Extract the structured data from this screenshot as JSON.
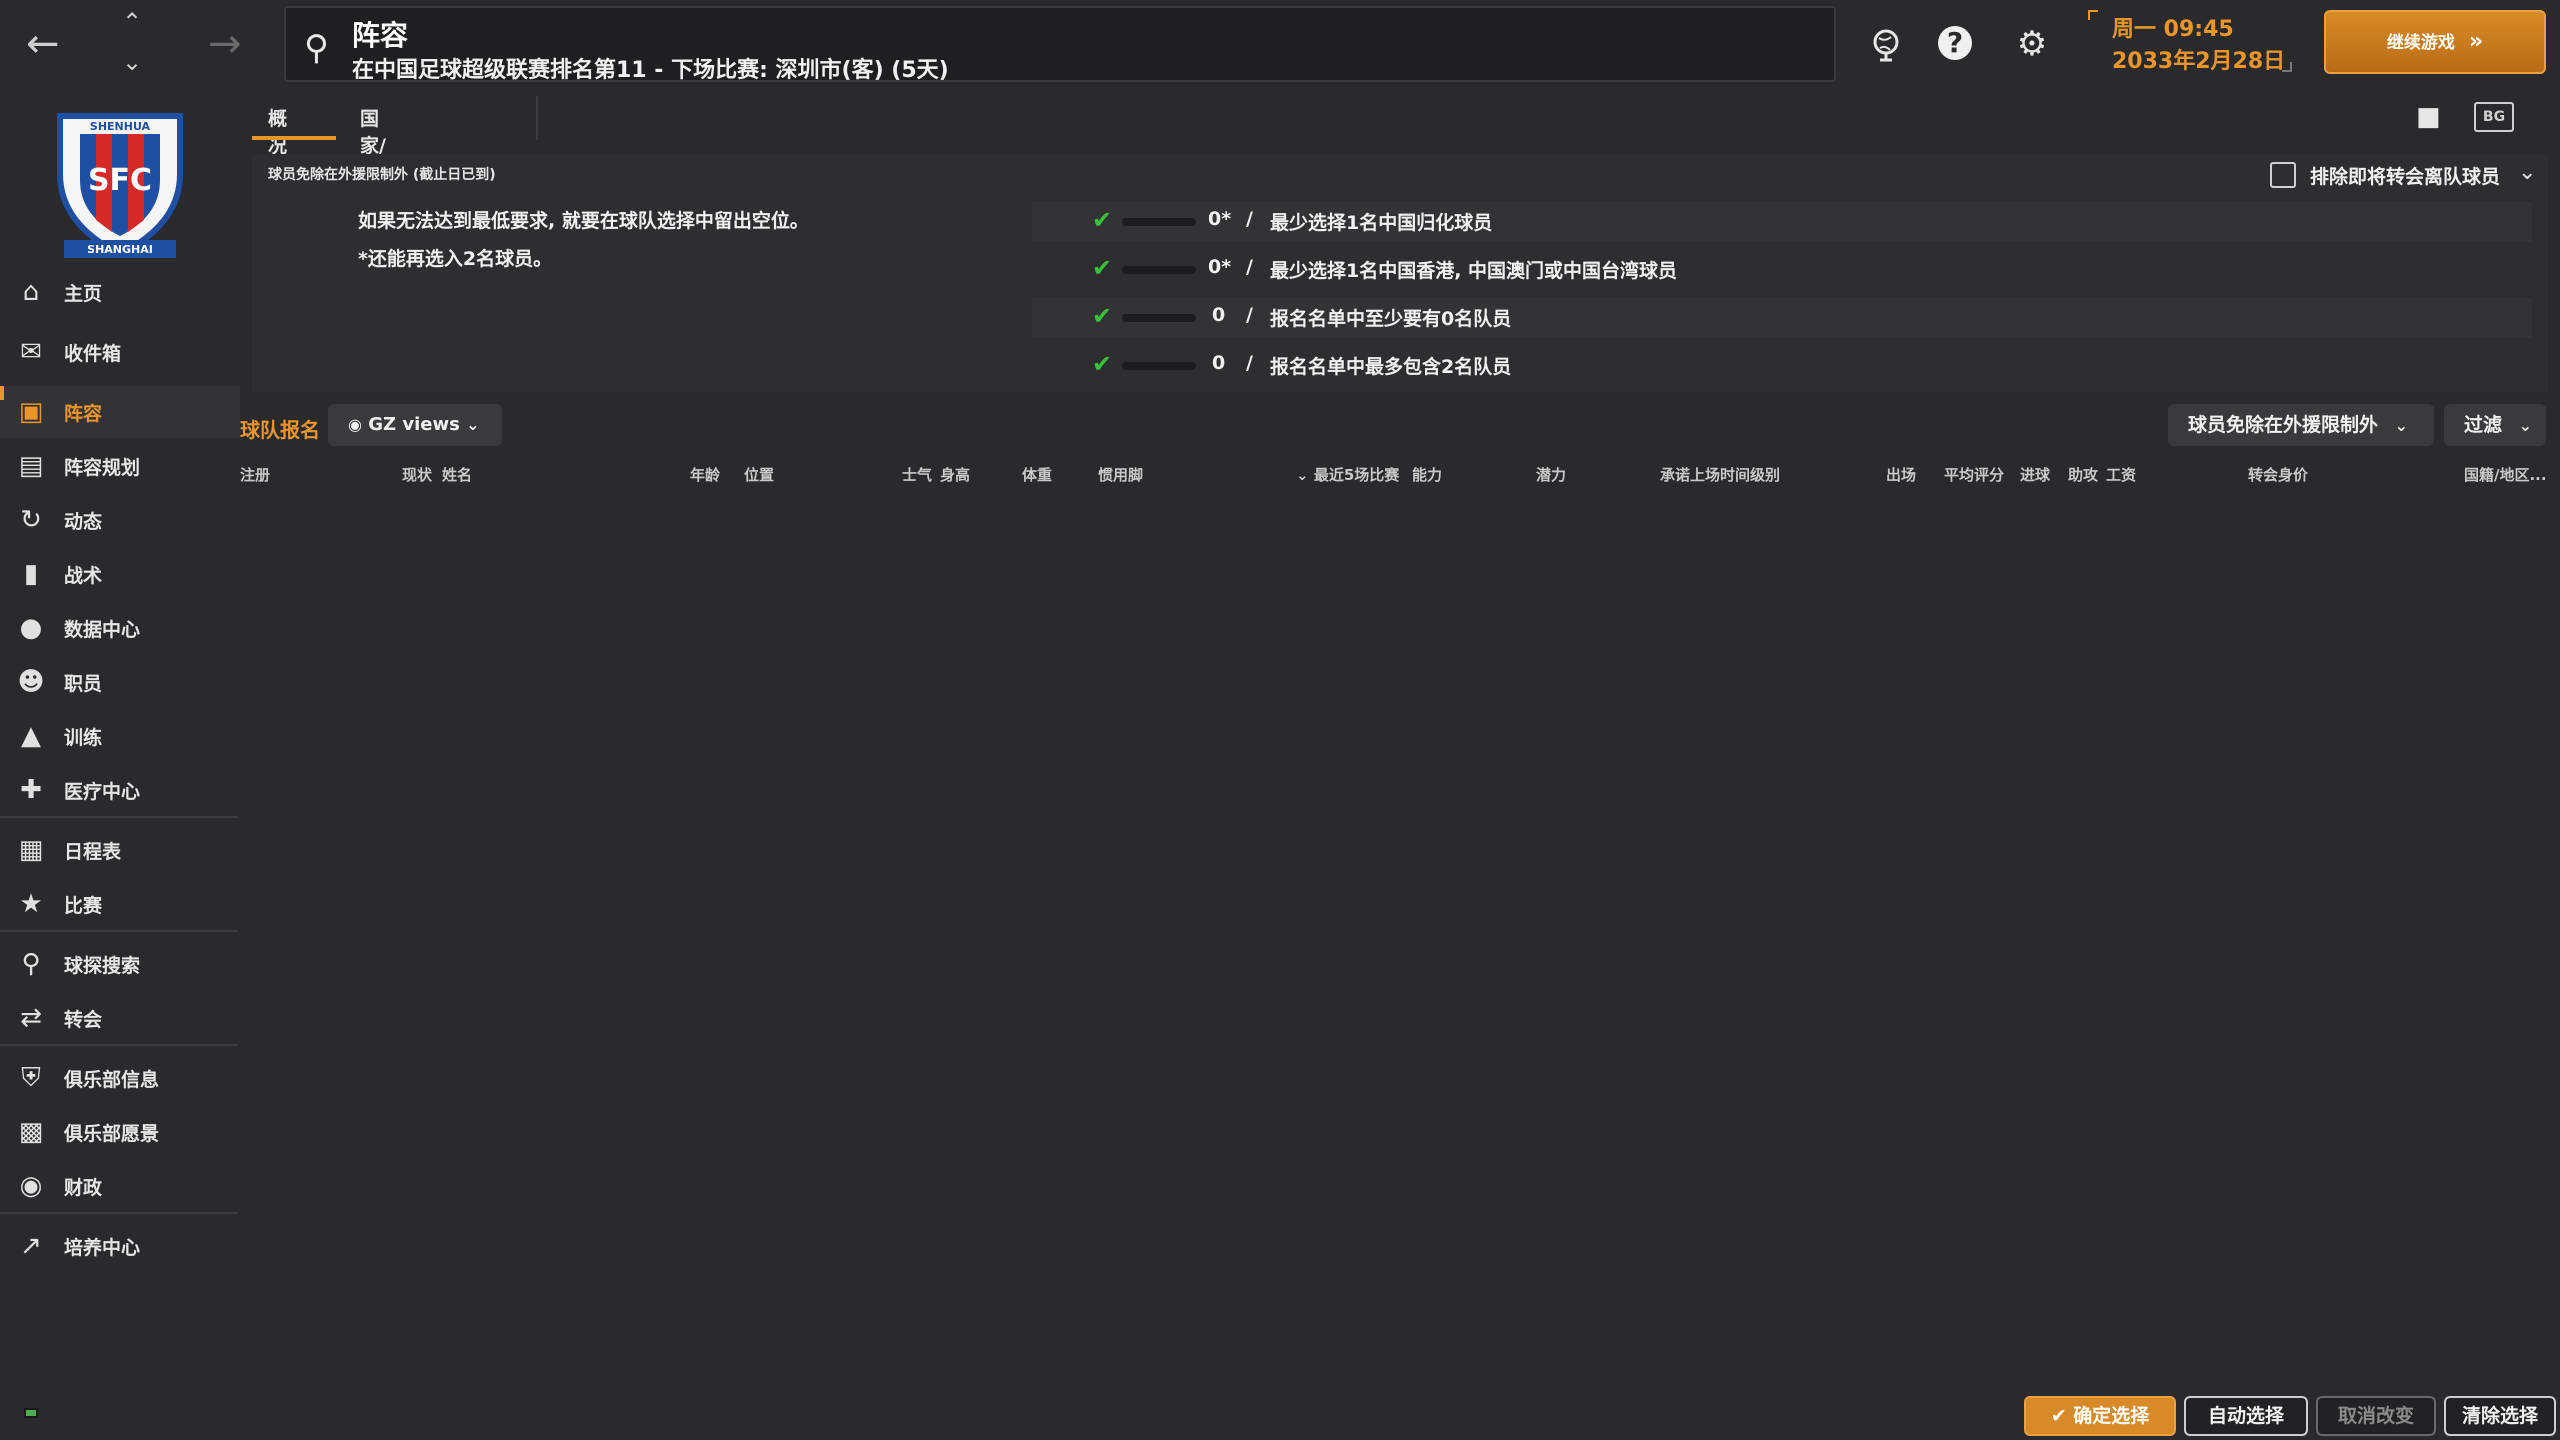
{
  "header": {
    "title": "阵容",
    "subtitle": "在中国足球超级联赛排名第11 - 下场比赛: 深圳市(客) (5天)",
    "datetime_line1": "周一 09:45",
    "datetime_line2": "2033年2月28日",
    "continue_label": "继续游戏"
  },
  "logo": {
    "text_top": "SHENHUA",
    "text_mid": "SFC",
    "text_bottom": "SHANGHAI",
    "primary_color": "#1f4fa3",
    "accent_color": "#d42a2a"
  },
  "sidebar": {
    "items": [
      {
        "label": "主页",
        "icon": "home-icon"
      },
      {
        "label": "收件箱",
        "icon": "inbox-icon"
      },
      {
        "label": "阵容",
        "icon": "squad-icon"
      },
      {
        "label": "阵容规划",
        "icon": "planner-icon"
      },
      {
        "label": "动态",
        "icon": "dynamics-icon"
      },
      {
        "label": "战术",
        "icon": "tactics-icon"
      },
      {
        "label": "数据中心",
        "icon": "data-hub-icon"
      },
      {
        "label": "职员",
        "icon": "staff-icon"
      },
      {
        "label": "训练",
        "icon": "training-icon"
      },
      {
        "label": "医疗中心",
        "icon": "medical-icon"
      },
      {
        "label": "日程表",
        "icon": "calendar-icon"
      },
      {
        "label": "比赛",
        "icon": "trophy-icon"
      },
      {
        "label": "球探搜索",
        "icon": "scouting-icon"
      },
      {
        "label": "转会",
        "icon": "transfer-icon"
      },
      {
        "label": "俱乐部信息",
        "icon": "club-info-icon"
      },
      {
        "label": "俱乐部愿景",
        "icon": "club-vision-icon"
      },
      {
        "label": "财政",
        "icon": "finance-icon"
      },
      {
        "label": "培养中心",
        "icon": "development-icon"
      }
    ]
  },
  "tabs": {
    "overview": "概况",
    "international": "国家/地区队比赛"
  },
  "panel": {
    "title": "球员免除在外援限制外 (截止日已到)",
    "msg1": "如果无法达到最低要求, 就要在球队选择中留出空位。",
    "msg2": "*还能再选入2名球员。",
    "exclude_label": "排除即将转会离队球员",
    "rules": [
      {
        "value": "0*",
        "label": "最少选择1名中国归化球员"
      },
      {
        "value": "0*",
        "label": "最少选择1名中国香港, 中国澳门或中国台湾球员"
      },
      {
        "value": "0",
        "label": "报名名单中至少要有0名队员"
      },
      {
        "value": "0",
        "label": "报名名单中最多包含2名队员"
      }
    ]
  },
  "registration": {
    "title": "球队报名",
    "views_label": "GZ views",
    "filter1_label": "球员免除在外援限制外",
    "filter2_label": "过滤"
  },
  "columns": [
    "注册",
    "现状",
    "姓名",
    "年龄",
    "位置",
    "士气",
    "身高",
    "体重",
    "惯用脚",
    "最近5场比赛",
    "能力",
    "潜力",
    "承诺上场时间级别",
    "出场",
    "平均评分",
    "进球",
    "助攻",
    "工资",
    "转会身价",
    "国籍/地区..."
  ],
  "bottom": {
    "confirm": "确定选择",
    "auto": "自动选择",
    "cancel": "取消改变",
    "clear": "清除选择"
  },
  "colors": {
    "accent": "#e8952a",
    "check": "#3ac13a",
    "background": "#2a2a2c"
  }
}
